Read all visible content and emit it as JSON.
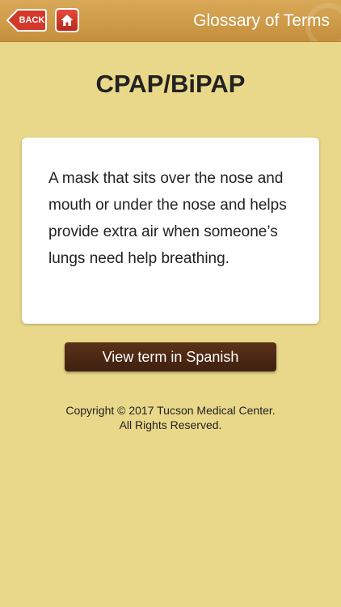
{
  "header": {
    "back_label": "BACK",
    "title": "Glossary of Terms",
    "icons": [
      "back-arrow-icon",
      "home-icon"
    ]
  },
  "term": {
    "title": "CPAP/BiPAP",
    "definition": "A mask that sits over the nose and mouth or under the nose and helps provide extra air when someone’s lungs need help breathing."
  },
  "actions": {
    "spanish_label": "View term in Spanish"
  },
  "footer": {
    "copyright_line1": "Copyright © 2017 Tucson Medical Center.",
    "copyright_line2": "All Rights Reserved."
  },
  "colors": {
    "background": "#e9d88a",
    "header": "#cf9c4a",
    "accent_red": "#d4382b",
    "button_brown": "#4a2714"
  }
}
